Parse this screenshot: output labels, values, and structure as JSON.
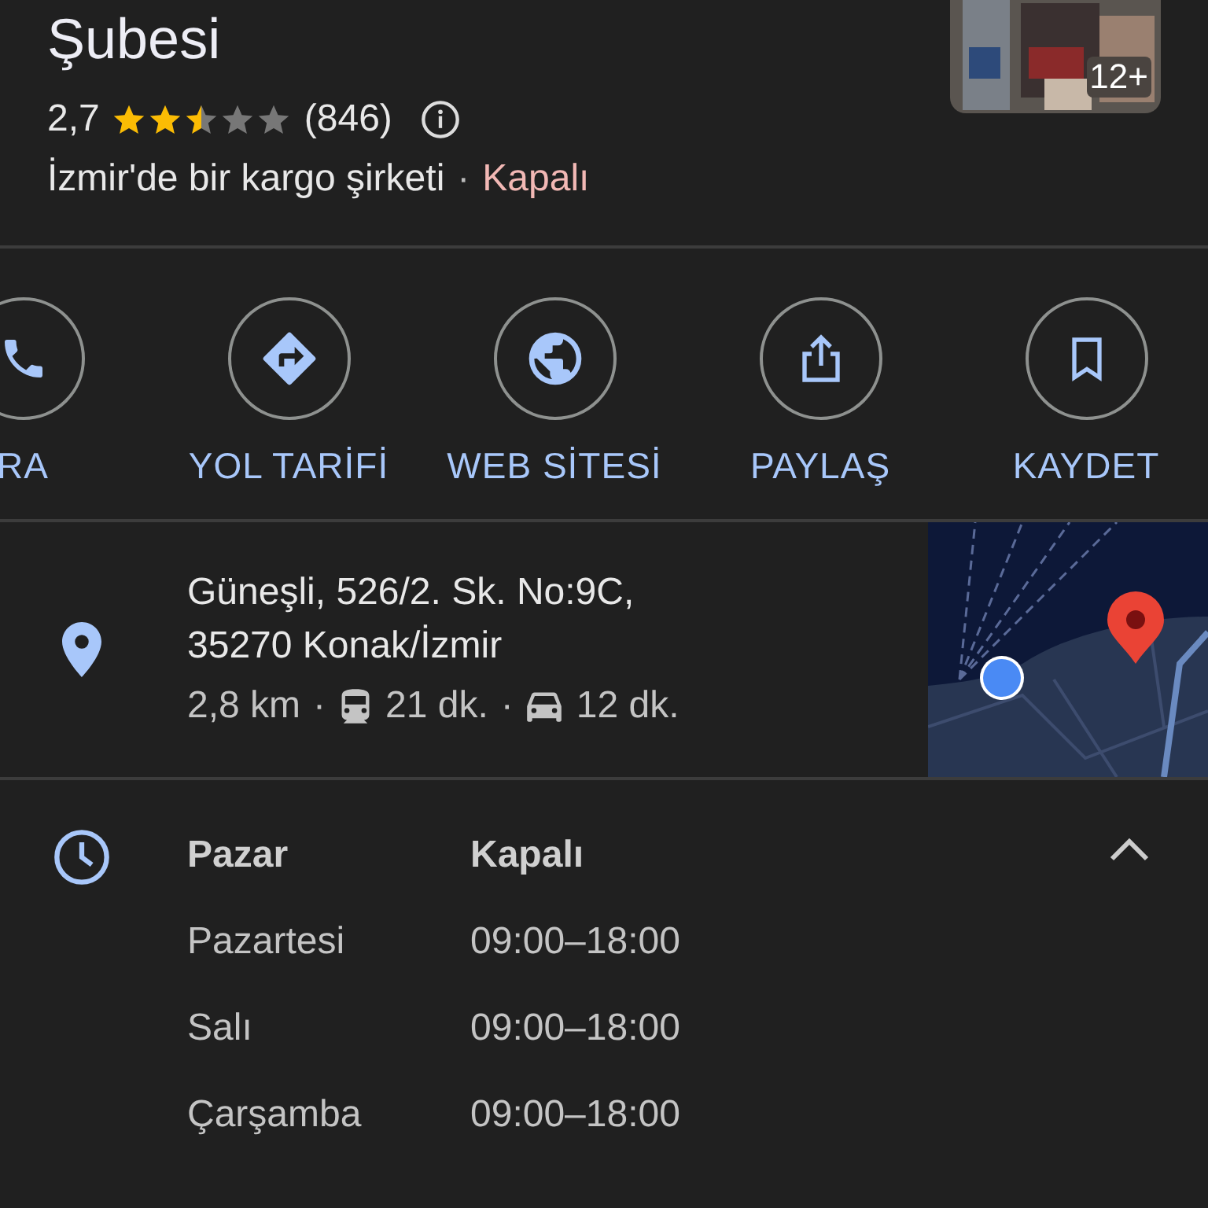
{
  "place": {
    "title": "Şubesi",
    "rating": "2,7",
    "stars": 2.5,
    "review_count": "(846)",
    "category": "İzmir'de bir kargo şirketi",
    "separator": "·",
    "status": "Kapalı",
    "photo_count": "12+"
  },
  "actions": [
    {
      "kind": "call",
      "label": "RA"
    },
    {
      "kind": "directions",
      "label": "YOL TARİFİ"
    },
    {
      "kind": "website",
      "label": "WEB SİTESİ"
    },
    {
      "kind": "share",
      "label": "PAYLAŞ"
    },
    {
      "kind": "save",
      "label": "KAYDET"
    }
  ],
  "address": {
    "lines": [
      "Güneşli, 526/2. Sk. No:9C,",
      "35270 Konak/İzmir"
    ],
    "distance": "2,8 km",
    "transit_time": "21 dk.",
    "drive_time": "12 dk.",
    "separator": "·"
  },
  "hours": {
    "expanded": true,
    "days": [
      {
        "day": "Pazar",
        "hours": "Kapalı",
        "today": true
      },
      {
        "day": "Pazartesi",
        "hours": "09:00–18:00",
        "today": false
      },
      {
        "day": "Salı",
        "hours": "09:00–18:00",
        "today": false
      },
      {
        "day": "Çarşamba",
        "hours": "09:00–18:00",
        "today": false
      }
    ]
  }
}
